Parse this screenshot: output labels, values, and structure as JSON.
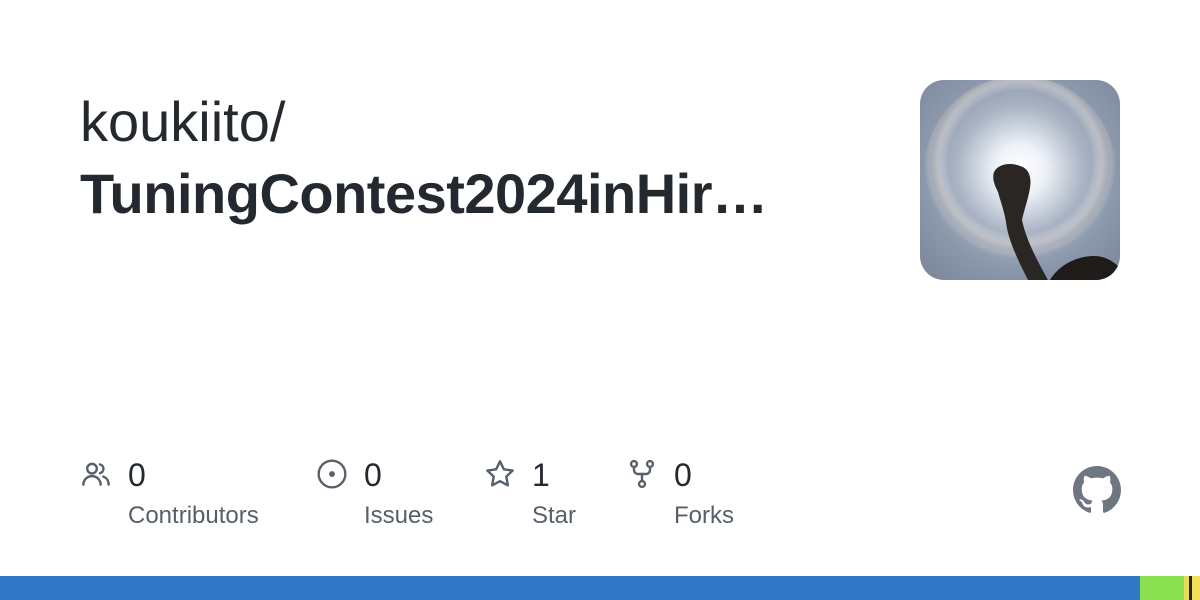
{
  "repo": {
    "owner": "koukiito/",
    "name": "TuningContest2024inHir…"
  },
  "stats": {
    "contributors": {
      "count": "0",
      "label": "Contributors",
      "icon": "people-icon"
    },
    "issues": {
      "count": "0",
      "label": "Issues",
      "icon": "issue-opened-icon"
    },
    "stars": {
      "count": "1",
      "label": "Star",
      "icon": "star-icon"
    },
    "forks": {
      "count": "0",
      "label": "Forks",
      "icon": "repo-forked-icon"
    }
  },
  "colors": {
    "text_primary": "#24292f",
    "text_secondary": "#57606a",
    "icon": "#57606a",
    "github_logo": "#6e7681"
  },
  "language_bar": [
    {
      "color": "#3178c6",
      "percent": 95.0
    },
    {
      "color": "#89e051",
      "percent": 3.7
    },
    {
      "color": "#e8dd5a",
      "percent": 0.35
    },
    {
      "color": "#24292f",
      "percent": 0.3
    },
    {
      "color": "#f1e05a",
      "percent": 0.65
    }
  ]
}
